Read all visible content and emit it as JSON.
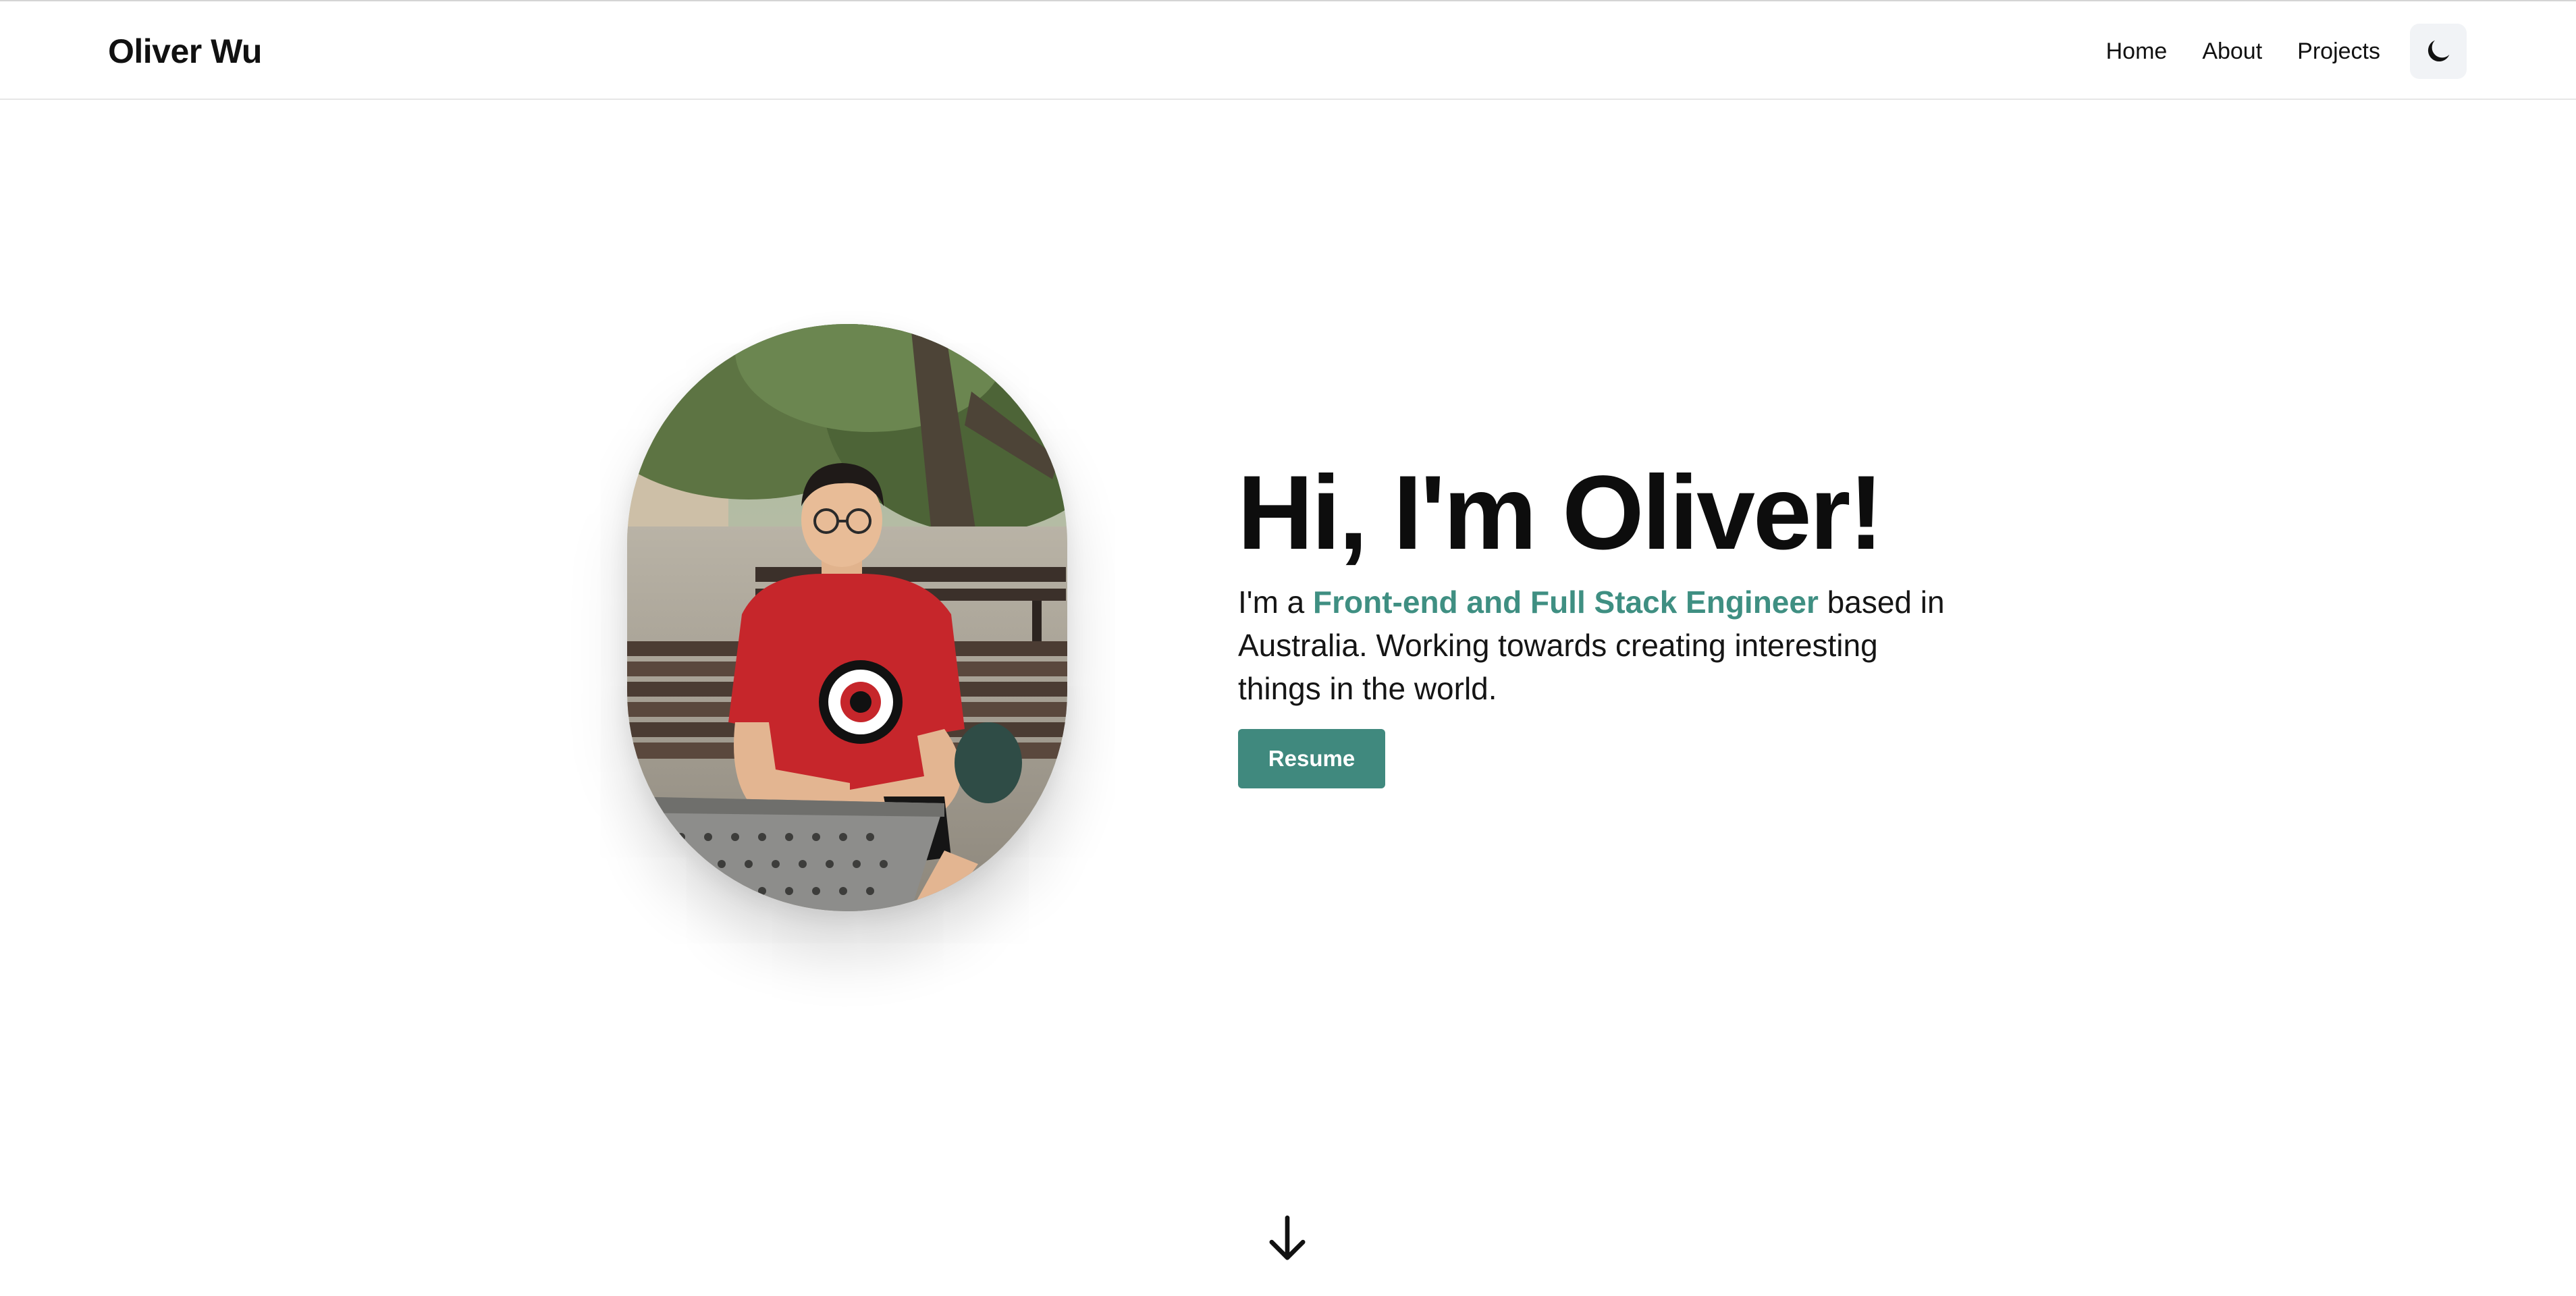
{
  "header": {
    "brand": "Oliver Wu",
    "nav": [
      {
        "label": "Home"
      },
      {
        "label": "About"
      },
      {
        "label": "Projects"
      }
    ],
    "theme_toggle_icon": "moon-icon"
  },
  "hero": {
    "headline": "Hi, I'm Oliver!",
    "intro_prefix": "I'm a ",
    "intro_highlight": "Front-end and Full Stack Engineer",
    "intro_suffix": " based in Australia. Working towards creating interesting things in the world.",
    "resume_label": "Resume",
    "avatar_icon": "profile-photo",
    "scroll_icon": "arrow-down-icon"
  },
  "colors": {
    "accent": "#40897e",
    "highlight_text": "#3f8f82",
    "text": "#111111",
    "background": "#ffffff",
    "toggle_bg": "#f1f3f6"
  }
}
